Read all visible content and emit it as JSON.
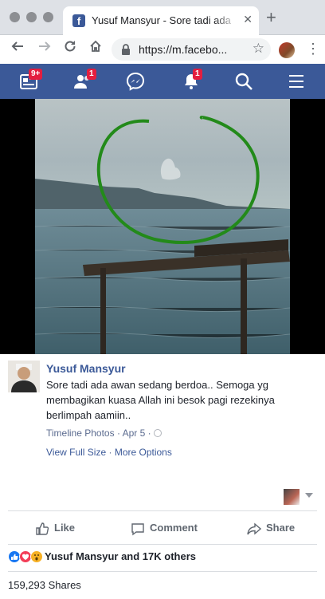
{
  "browser": {
    "tab_title": "Yusuf Mansyur - Sore tadi ada",
    "url": "https://m.facebo..."
  },
  "fb_nav": {
    "items": [
      {
        "icon": "feed-icon",
        "badge": "9+"
      },
      {
        "icon": "friend-requests-icon",
        "badge": "1"
      },
      {
        "icon": "messenger-icon",
        "badge": ""
      },
      {
        "icon": "notifications-icon",
        "badge": "1"
      },
      {
        "icon": "search-icon",
        "badge": ""
      },
      {
        "icon": "menu-icon",
        "badge": ""
      }
    ],
    "color": "#3b5998"
  },
  "post": {
    "author": "Yusuf Mansyur",
    "text": "Sore tadi ada awan sedang berdoa.. Semoga yg membagikan kuasa Allah ini besok pagi rezekinya berlimpah aamiin..",
    "album": "Timeline Photos",
    "date": "Apr 5",
    "view_full_size": "View Full Size",
    "more_options": "More Options"
  },
  "actions": {
    "like": "Like",
    "comment": "Comment",
    "share": "Share"
  },
  "reactions": {
    "summary": "Yusuf Mansyur and 17K others",
    "types": [
      "like",
      "love",
      "wow"
    ]
  },
  "shares": "159,293 Shares"
}
